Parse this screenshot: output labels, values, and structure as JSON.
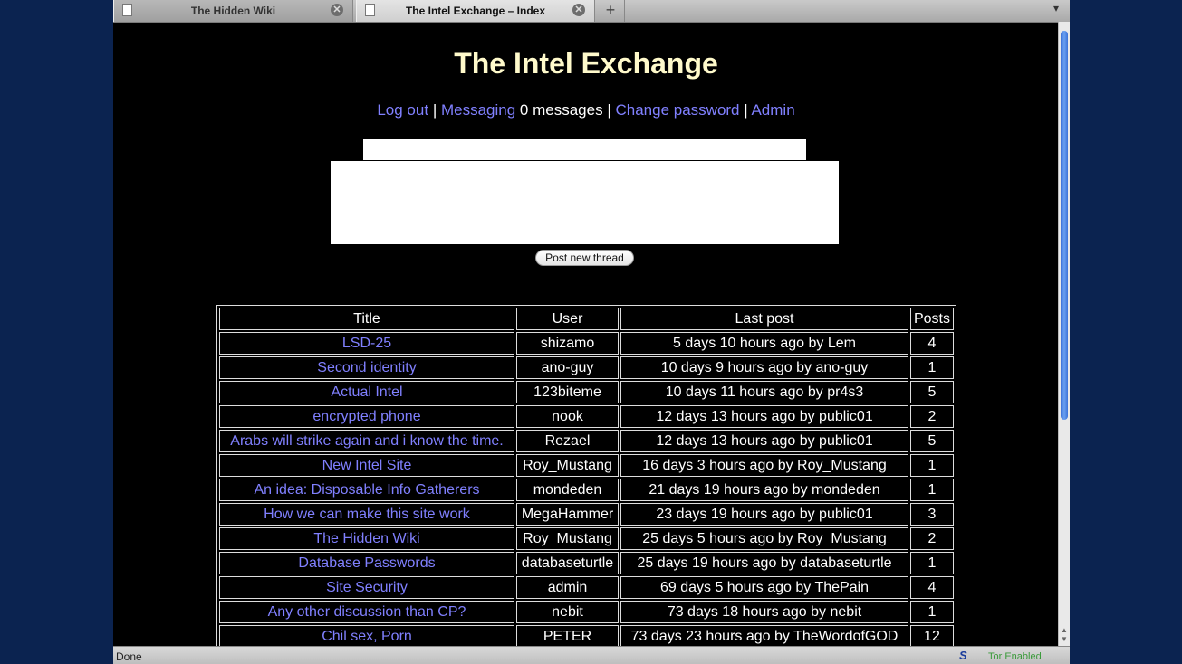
{
  "browser": {
    "tabs": [
      {
        "label": "The Hidden Wiki",
        "active": false
      },
      {
        "label": "The Intel Exchange – Index",
        "active": true
      }
    ],
    "status": "Done",
    "tor_status": "Tor Enabled"
  },
  "page": {
    "title": "The Intel Exchange",
    "nav": {
      "logout": "Log out",
      "sep1": "|",
      "messaging": "Messaging",
      "messages_count": "0 messages",
      "sep2": "|",
      "change_password": "Change password",
      "sep3": "|",
      "admin": "Admin"
    },
    "form": {
      "title_value": "",
      "body_value": "",
      "post_button": "Post new thread"
    },
    "table": {
      "headers": {
        "title": "Title",
        "user": "User",
        "last": "Last post",
        "posts": "Posts"
      },
      "rows": [
        {
          "title": "LSD-25",
          "user": "shizamo",
          "last": "5 days 10 hours ago by Lem",
          "posts": "4"
        },
        {
          "title": "Second identity",
          "user": "ano-guy",
          "last": "10 days 9 hours ago by ano-guy",
          "posts": "1"
        },
        {
          "title": "Actual Intel",
          "user": "123biteme",
          "last": "10 days 11 hours ago by pr4s3",
          "posts": "5"
        },
        {
          "title": "encrypted phone",
          "user": "nook",
          "last": "12 days 13 hours ago by public01",
          "posts": "2"
        },
        {
          "title": "Arabs will strike again and i know the time.",
          "user": "Rezael",
          "last": "12 days 13 hours ago by public01",
          "posts": "5"
        },
        {
          "title": "New Intel Site",
          "user": "Roy_Mustang",
          "last": "16 days 3 hours ago by Roy_Mustang",
          "posts": "1"
        },
        {
          "title": "An idea: Disposable Info Gatherers",
          "user": "mondeden",
          "last": "21 days 19 hours ago by mondeden",
          "posts": "1"
        },
        {
          "title": "How we can make this site work",
          "user": "MegaHammer",
          "last": "23 days 19 hours ago by public01",
          "posts": "3"
        },
        {
          "title": "The Hidden Wiki",
          "user": "Roy_Mustang",
          "last": "25 days 5 hours ago by Roy_Mustang",
          "posts": "2"
        },
        {
          "title": "Database Passwords",
          "user": "databaseturtle",
          "last": "25 days 19 hours ago by databaseturtle",
          "posts": "1"
        },
        {
          "title": "Site Security",
          "user": "admin",
          "last": "69 days 5 hours ago by ThePain",
          "posts": "4"
        },
        {
          "title": "Any other discussion than CP?",
          "user": "nebit",
          "last": "73 days 18 hours ago by nebit",
          "posts": "1"
        },
        {
          "title": "Chil sex, Porn",
          "user": "PETER",
          "last": "73 days 23 hours ago by TheWordofGOD",
          "posts": "12"
        }
      ]
    }
  }
}
